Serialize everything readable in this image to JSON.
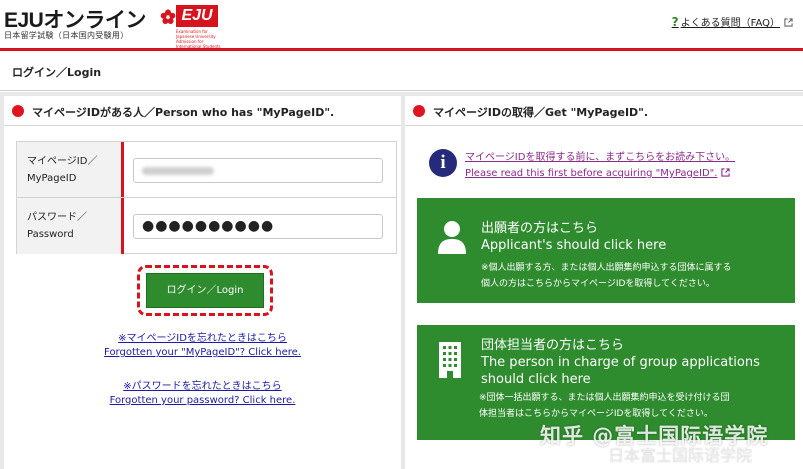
{
  "header": {
    "logo_text": "EJUオンライン",
    "logo_badge": "EJU",
    "logo_subtitle": "日本留学試験（日本国内受験用）",
    "logo_org": "Examination for Japanese University Admission for International Students",
    "faq_mark": "?",
    "faq_label": "よくある質問（FAQ）"
  },
  "page": {
    "title": "ログイン／Login"
  },
  "left_panel": {
    "heading": "マイページIDがある人／Person who has \"MyPageID\".",
    "fields": [
      {
        "label_ja": "マイページID／",
        "label_en": "MyPageID",
        "value": ""
      },
      {
        "label_ja": "パスワード／",
        "label_en": "Password",
        "value": "●●●●●●●●●●"
      }
    ],
    "login_button": "ログイン／Login",
    "forgot_id_ja": "※マイページIDを忘れたときはこちら",
    "forgot_id_en": "Forgotten your \"MyPageID\"? Click here.",
    "forgot_pw_ja": "※パスワードを忘れたときはこちら",
    "forgot_pw_en": "Forgotten your password? Click here."
  },
  "right_panel": {
    "heading": "マイページIDの取得／Get \"MyPageID\".",
    "info_mark": "i",
    "info_ja": "マイページIDを取得する前に、まずこちらをお読み下さい。",
    "info_en": "Please read this first before acquiring \"MyPageID\".",
    "applicant": {
      "title_ja": "出願者の方はこちら",
      "title_en": "Applicant's should click here",
      "note1": "※個人出願する方、または個人出願集約申込する団体に属する",
      "note2": "個人の方はこちらからマイページIDを取得してください。"
    },
    "group": {
      "title_ja": "団体担当者の方はこちら",
      "title_en1": "The person in charge of group applications",
      "title_en2": "should click here",
      "note1": "※団体一括出願する、または個人出願集約申込を受け付ける団",
      "note2": "体担当者はこちらからマイページIDを取得してください。"
    }
  },
  "watermark": {
    "line1": "知乎 @富士国际语学院",
    "line2": "日本富士国际语学院"
  },
  "colors": {
    "brand_red": "#d7141e",
    "button_green": "#2e8b2e",
    "info_navy": "#262a7a"
  }
}
